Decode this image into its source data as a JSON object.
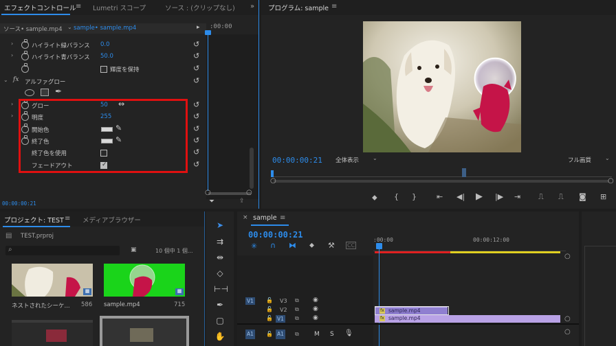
{
  "effect_controls": {
    "tabs": [
      "エフェクトコントロール",
      "Lumetri スコープ",
      "ソース : (クリップなし)"
    ],
    "source_label": "ソース• sample.mp4",
    "sequence_label": "sample• sample.mp4",
    "timecode_head": ":00:00",
    "rows": [
      {
        "label": "ハイライト緑バランス",
        "value": "0.0"
      },
      {
        "label": "ハイライト青バランス",
        "value": "50.0"
      },
      {
        "label": "",
        "value": ""
      }
    ],
    "keep_luma_label": "輝度を保持",
    "section_label": "アルファグロー",
    "glow_rows": [
      {
        "label": "グロー",
        "value": "50"
      },
      {
        "label": "明度",
        "value": "255"
      },
      {
        "label": "開始色",
        "value": ""
      },
      {
        "label": "終了色",
        "value": ""
      },
      {
        "label": "終了色を使用",
        "value": ""
      },
      {
        "label": "フェードアウト",
        "value": ""
      }
    ],
    "footer_timecode": "00:00:00:21"
  },
  "program": {
    "title": "プログラム: sample",
    "timecode": "00:00:00:21",
    "zoom": "全体表示",
    "quality": "フル画質"
  },
  "project": {
    "tabs": [
      "プロジェクト: TEST",
      "メディアブラウザー"
    ],
    "file": "TEST.prproj",
    "count": "10 個中 1 個...",
    "items": [
      {
        "name": "ネストされたシーケ...",
        "duration": "586"
      },
      {
        "name": "sample.mp4",
        "duration": "715"
      }
    ]
  },
  "timeline": {
    "sequence": "sample",
    "timecode": "00:00:00:21",
    "ruler": [
      ":00:00",
      "00:00:12:00"
    ],
    "tracks": {
      "v3": "V3",
      "v2": "V2",
      "v1": "V1",
      "a1": "A1"
    },
    "clips": {
      "v2": "sample.mp4",
      "v1": "sample.mp4"
    },
    "mute": "M",
    "solo": "S"
  },
  "colors": {
    "accent": "#2d8ceb",
    "highlight_box": "#e01010",
    "clip_v2": "#8f7fd0",
    "clip_v1": "#b9a2e6"
  }
}
